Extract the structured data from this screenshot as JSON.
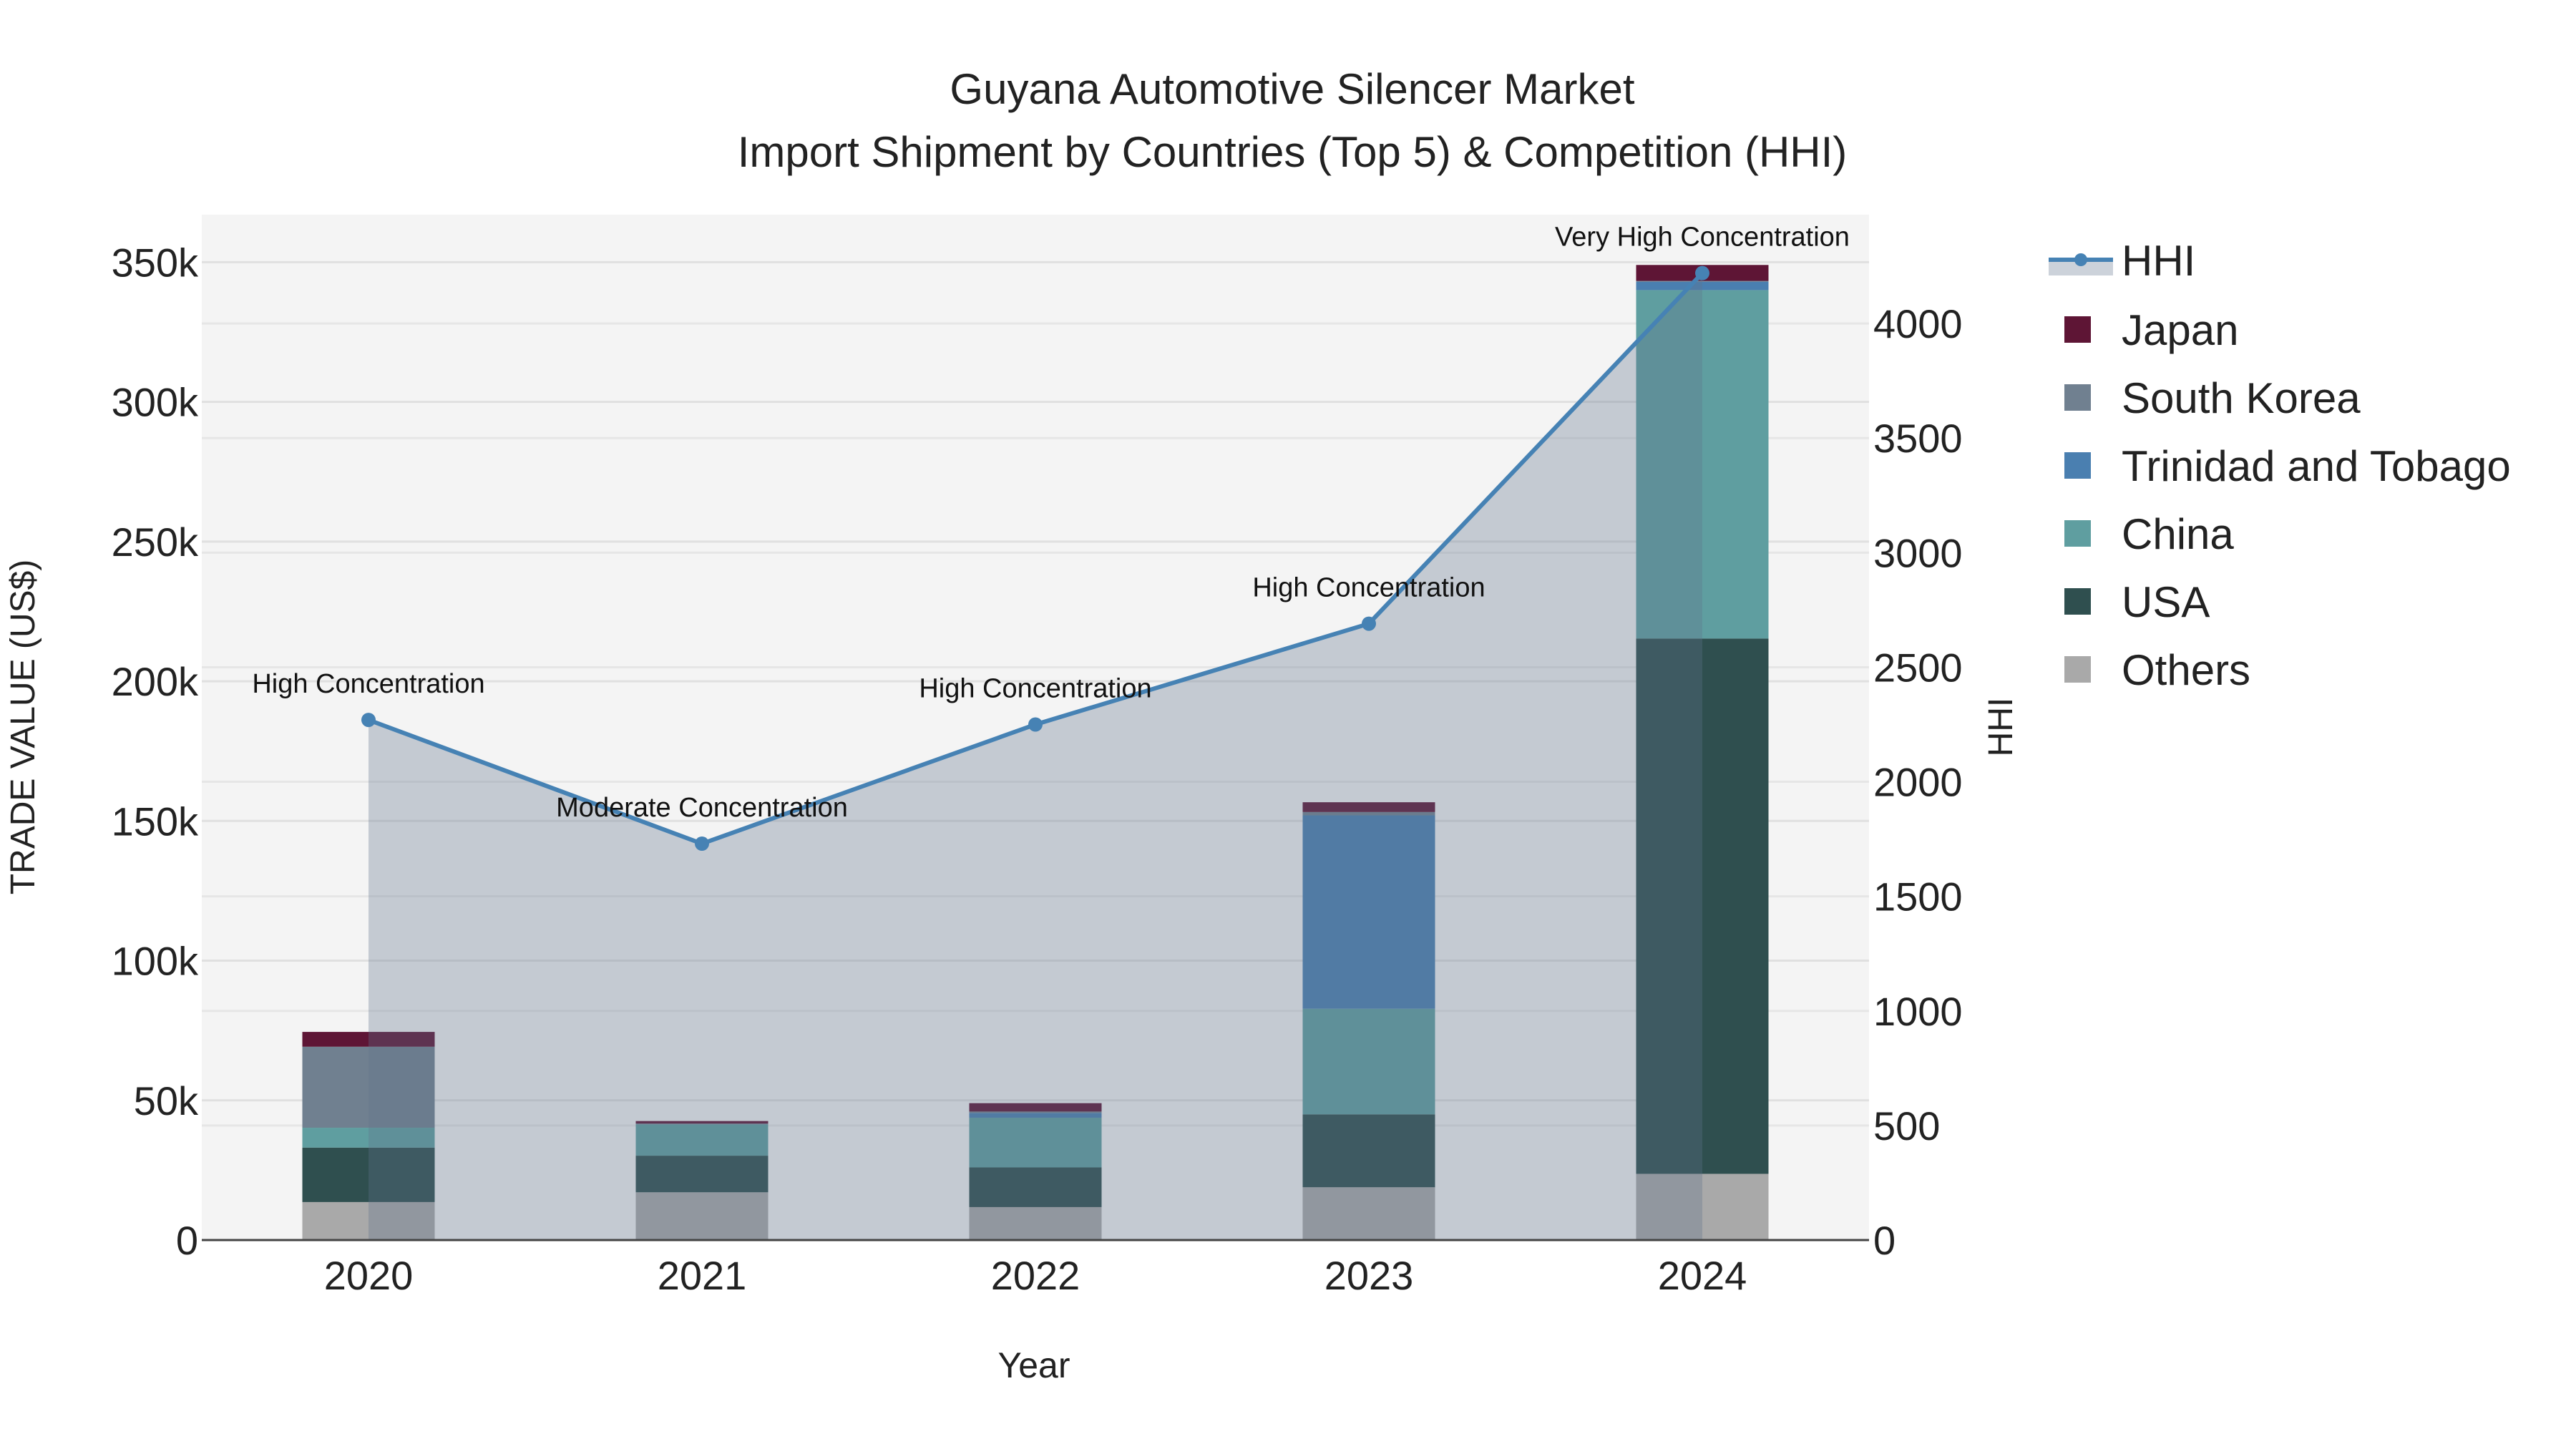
{
  "chart_data": {
    "type": "bar",
    "title": "Guyana Automotive Silencer Market",
    "subtitle": "Import Shipment by Countries (Top 5) & Competition (HHI)",
    "xlabel": "Year",
    "ylabel": "TRADE VALUE (US$)",
    "y2label": "HHI",
    "categories": [
      "2020",
      "2021",
      "2022",
      "2023",
      "2024"
    ],
    "ylim": [
      0,
      367000
    ],
    "y2lim": [
      0,
      4475
    ],
    "yticks": [
      0,
      50000,
      100000,
      150000,
      200000,
      250000,
      300000,
      350000
    ],
    "ytick_labels": [
      "0",
      "50k",
      "100k",
      "150k",
      "200k",
      "250k",
      "300k",
      "350k"
    ],
    "y2ticks": [
      0,
      500,
      1000,
      1500,
      2000,
      2500,
      3000,
      3500,
      4000
    ],
    "y2tick_labels": [
      "0",
      "500",
      "1000",
      "1500",
      "2000",
      "2500",
      "3000",
      "3500",
      "4000"
    ],
    "stacking": "stacked",
    "legend_position": "right",
    "series": [
      {
        "name": "Others",
        "color": "#a9a9a9",
        "values": [
          13600,
          17100,
          11800,
          18900,
          23700
        ]
      },
      {
        "name": "USA",
        "color": "#2f4f4f",
        "values": [
          19500,
          13100,
          14200,
          26100,
          191600
        ]
      },
      {
        "name": "China",
        "color": "#5f9ea0",
        "values": [
          7100,
          11200,
          17800,
          37800,
          124700
        ]
      },
      {
        "name": "Trinidad and Tobago",
        "color": "#4a7fb0",
        "values": [
          0,
          0,
          1700,
          69200,
          3000
        ]
      },
      {
        "name": "South Korea",
        "color": "#708090",
        "values": [
          29000,
          300,
          500,
          1200,
          300
        ]
      },
      {
        "name": "Japan",
        "color": "#5e1535",
        "values": [
          5300,
          900,
          3000,
          3500,
          5700
        ]
      }
    ],
    "hhi": {
      "name": "HHI",
      "color": "#4682b4",
      "values": [
        2270,
        1730,
        2250,
        2690,
        4220
      ],
      "annotations": [
        "High Concentration",
        "Moderate Concentration",
        "High Concentration",
        "High Concentration",
        "Very High Concentration"
      ]
    },
    "legend_order": [
      "HHI",
      "Japan",
      "South Korea",
      "Trinidad and Tobago",
      "China",
      "USA",
      "Others"
    ]
  }
}
